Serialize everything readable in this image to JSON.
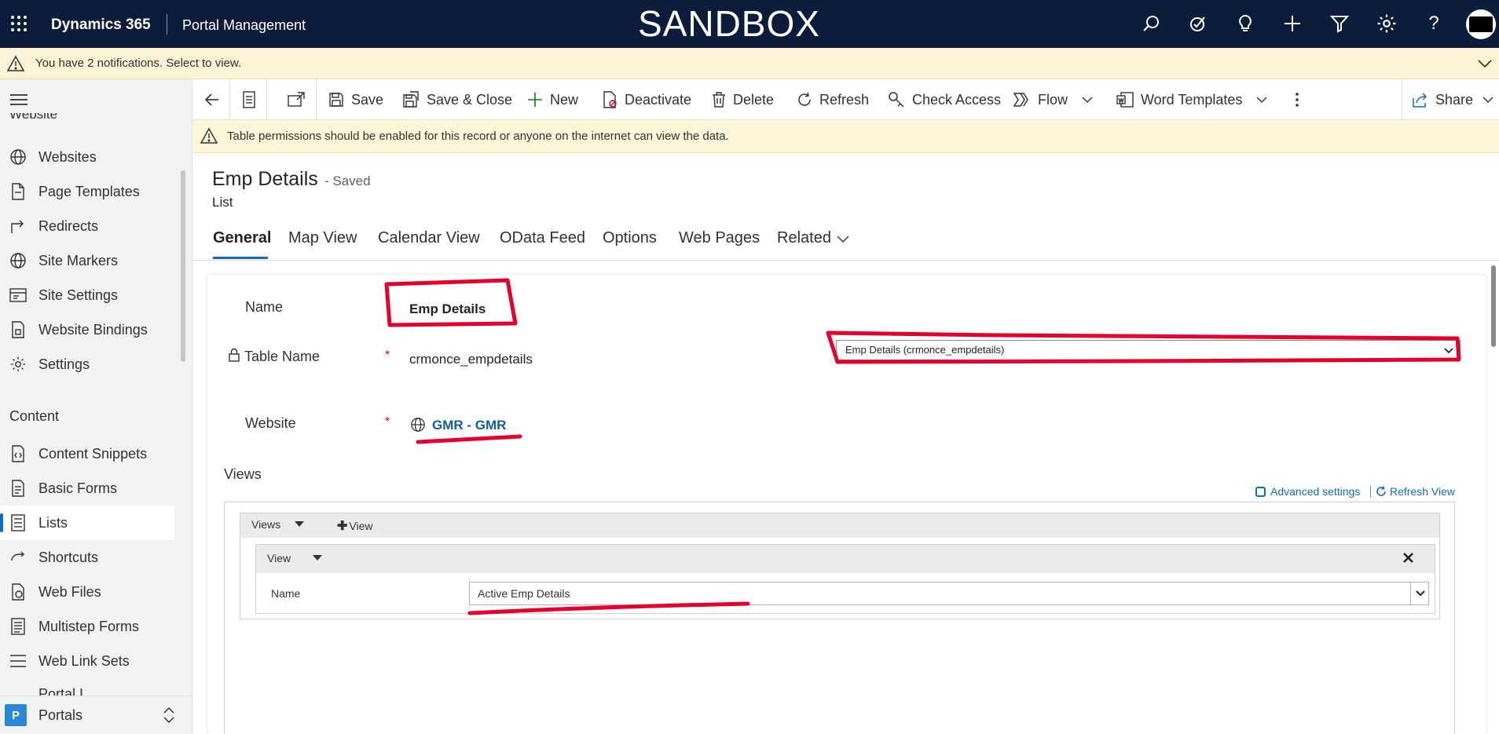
{
  "topbar": {
    "app_name": "Dynamics 365",
    "area_name": "Portal Management",
    "environment": "SANDBOX"
  },
  "notifications": {
    "text": "You have 2 notifications. Select to view."
  },
  "sidebar": {
    "cut_top_label": "Website",
    "website_items": [
      {
        "label": "Websites",
        "icon": "globe-icon"
      },
      {
        "label": "Page Templates",
        "icon": "page-template-icon"
      },
      {
        "label": "Redirects",
        "icon": "redirect-icon"
      },
      {
        "label": "Site Markers",
        "icon": "globe-icon"
      },
      {
        "label": "Site Settings",
        "icon": "site-settings-icon"
      },
      {
        "label": "Website Bindings",
        "icon": "bindings-icon"
      },
      {
        "label": "Settings",
        "icon": "gear-icon"
      }
    ],
    "content_group_label": "Content",
    "content_items": [
      {
        "label": "Content Snippets",
        "icon": "snippet-icon"
      },
      {
        "label": "Basic Forms",
        "icon": "form-icon"
      },
      {
        "label": "Lists",
        "icon": "list-icon"
      },
      {
        "label": "Shortcuts",
        "icon": "shortcut-icon"
      },
      {
        "label": "Web Files",
        "icon": "web-file-icon"
      },
      {
        "label": "Multistep Forms",
        "icon": "multistep-icon"
      },
      {
        "label": "Web Link Sets",
        "icon": "link-set-icon"
      }
    ],
    "cut_bottom_label": "Portal I",
    "area_switcher": {
      "badge": "P",
      "label": "Portals"
    }
  },
  "commandbar": {
    "save": "Save",
    "save_close": "Save & Close",
    "new": "New",
    "deactivate": "Deactivate",
    "delete": "Delete",
    "refresh": "Refresh",
    "check_access": "Check Access",
    "flow": "Flow",
    "word_templates": "Word Templates",
    "share": "Share"
  },
  "warning": {
    "text": "Table permissions should be enabled for this record or anyone on the internet can view the data."
  },
  "record": {
    "title": "Emp Details",
    "status": "- Saved",
    "entity": "List"
  },
  "tabs": [
    "General",
    "Map View",
    "Calendar View",
    "OData Feed",
    "Options",
    "Web Pages",
    "Related"
  ],
  "form": {
    "name_label": "Name",
    "name_value": "Emp Details",
    "table_name_label": "Table Name",
    "table_name_value": "crmonce_empdetails",
    "table_select_value": "Emp Details (crmonce_empdetails)",
    "required_marker": "*",
    "website_label": "Website",
    "website_value": "GMR - GMR",
    "views_label": "Views"
  },
  "views_editor": {
    "advanced_settings": "Advanced settings",
    "refresh_view": "Refresh View",
    "views_dropdown": "Views",
    "add_view": "View",
    "view_header": "View",
    "name_label": "Name",
    "name_value": "Active Emp Details"
  },
  "colors": {
    "topbar": "#0b1d3a",
    "accent": "#0f6cbd",
    "annotation": "#e4002b",
    "notification_bg": "#fbf3d5"
  }
}
